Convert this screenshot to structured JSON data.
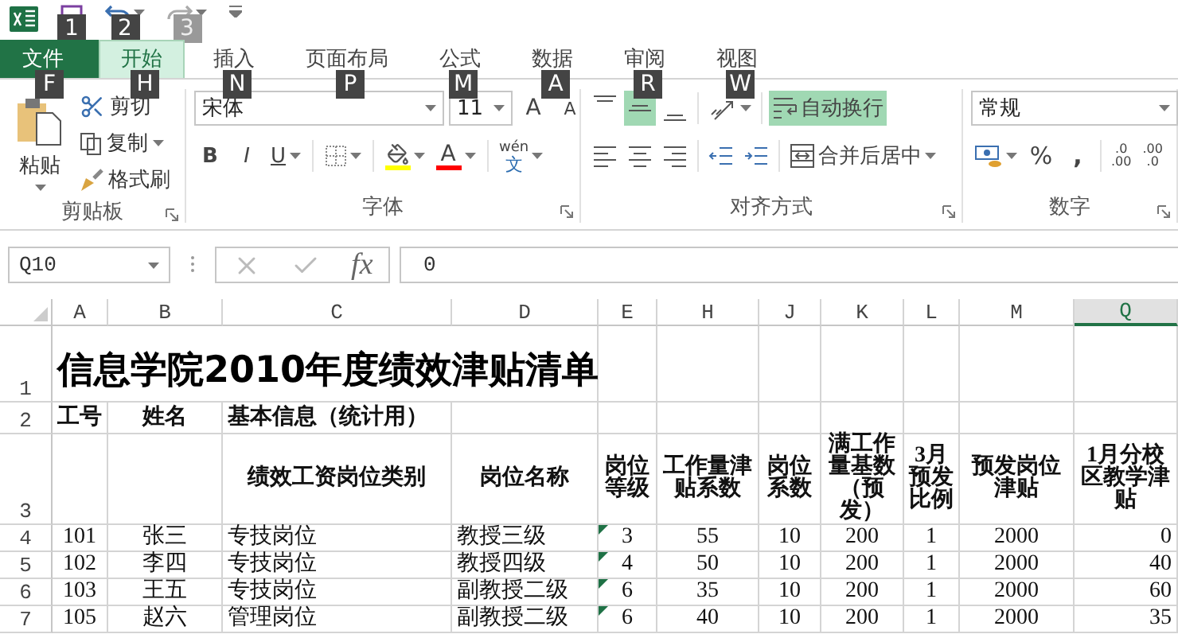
{
  "quick_access": {
    "keytips": [
      "1",
      "2",
      "3"
    ]
  },
  "tabs": [
    {
      "label": "文件",
      "keytip": "F",
      "kind": "file",
      "selected": false
    },
    {
      "label": "开始",
      "keytip": "H",
      "kind": "tab",
      "selected": true
    },
    {
      "label": "插入",
      "keytip": "N",
      "kind": "tab",
      "selected": false
    },
    {
      "label": "页面布局",
      "keytip": "P",
      "kind": "tab",
      "selected": false
    },
    {
      "label": "公式",
      "keytip": "M",
      "kind": "tab",
      "selected": false
    },
    {
      "label": "数据",
      "keytip": "A",
      "kind": "tab",
      "selected": false
    },
    {
      "label": "审阅",
      "keytip": "R",
      "kind": "tab",
      "selected": false
    },
    {
      "label": "视图",
      "keytip": "W",
      "kind": "tab",
      "selected": false
    }
  ],
  "ribbon": {
    "clipboard": {
      "title": "剪贴板",
      "paste": "粘贴",
      "cut": "剪切",
      "copy": "复制",
      "format_painter": "格式刷"
    },
    "font": {
      "title": "字体",
      "font_name": "宋体",
      "font_size": "11",
      "grow": "A",
      "shrink": "A",
      "bold": "B",
      "italic": "I",
      "underline": "U",
      "font_color": "A",
      "phonetic": "wén",
      "phonetic_char": "文"
    },
    "alignment": {
      "title": "对齐方式",
      "vertical": [
        {
          "kind": "top",
          "selected": false
        },
        {
          "kind": "middle",
          "selected": true
        },
        {
          "kind": "bottom",
          "selected": false
        }
      ],
      "wrap_text": {
        "label": "自动换行",
        "on": true
      },
      "merge": "合并后居中"
    },
    "number": {
      "title": "数字",
      "format": "常规",
      "percent": "%",
      "comma": ",",
      "increase_decimal": [
        ".0",
        ".00"
      ],
      "decrease_decimal": [
        ".00",
        ".0"
      ]
    }
  },
  "formula_bar": {
    "name_box": "Q10",
    "fx": "fx",
    "value": "0"
  },
  "sheet": {
    "columns": [
      {
        "label": "A",
        "selected": false
      },
      {
        "label": "B",
        "selected": false
      },
      {
        "label": "C",
        "selected": false
      },
      {
        "label": "D",
        "selected": false
      },
      {
        "label": "E",
        "selected": false
      },
      {
        "label": "H",
        "selected": false
      },
      {
        "label": "J",
        "selected": false
      },
      {
        "label": "K",
        "selected": false
      },
      {
        "label": "L",
        "selected": false
      },
      {
        "label": "M",
        "selected": false
      },
      {
        "label": "Q",
        "selected": true
      }
    ],
    "title_row": {
      "number": "1",
      "text": "信息学院2010年度绩效津贴清单"
    },
    "group_row": {
      "number": "2",
      "cells": [
        "工号",
        "姓名",
        "基本信息（统计用）"
      ]
    },
    "header_row": {
      "number": "3",
      "cells": [
        "绩效工资岗位类别",
        "岗位名称",
        "岗位等级",
        "工作量津贴系数",
        "岗位系数",
        "满工作量基数（预发）",
        "3月预发比例",
        "预发岗位津贴",
        "1月分校区教学津贴"
      ]
    },
    "rows": [
      {
        "number": "4",
        "flagged": true,
        "cells": [
          "101",
          "张三",
          "专技岗位",
          "教授三级",
          "3",
          "55",
          "10",
          "200",
          "1",
          "2000",
          "0"
        ]
      },
      {
        "number": "5",
        "flagged": true,
        "cells": [
          "102",
          "李四",
          "专技岗位",
          "教授四级",
          "4",
          "50",
          "10",
          "200",
          "1",
          "2000",
          "40"
        ]
      },
      {
        "number": "6",
        "flagged": true,
        "cells": [
          "103",
          "王五",
          "专技岗位",
          "副教授二级",
          "6",
          "35",
          "10",
          "200",
          "1",
          "2000",
          "60"
        ]
      },
      {
        "number": "7",
        "flagged": true,
        "cells": [
          "105",
          "赵六",
          "管理岗位",
          "副教授二级",
          "6",
          "40",
          "10",
          "200",
          "1",
          "2000",
          "35"
        ]
      }
    ]
  }
}
